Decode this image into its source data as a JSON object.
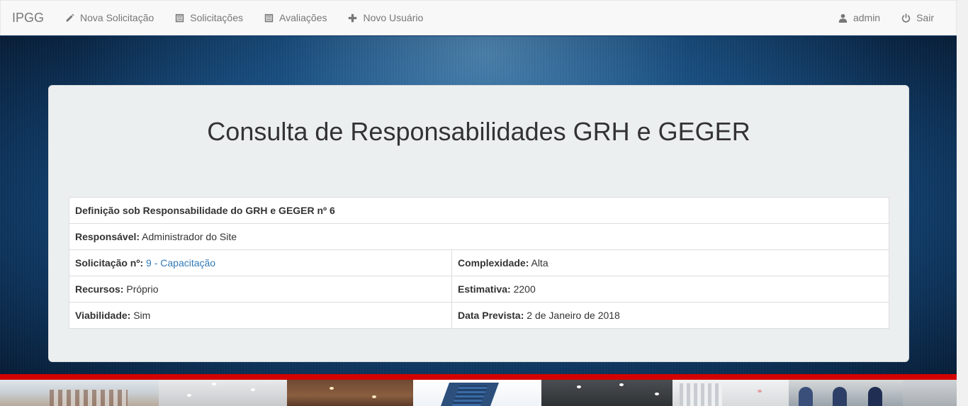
{
  "nav": {
    "brand": "IPGG",
    "items": [
      {
        "label": "Nova Solicitação",
        "icon": "pencil-icon"
      },
      {
        "label": "Solicitações",
        "icon": "list-icon"
      },
      {
        "label": "Avaliações",
        "icon": "list-icon"
      },
      {
        "label": "Novo Usuário",
        "icon": "plus-icon"
      }
    ],
    "user": {
      "label": "admin",
      "icon": "user-icon"
    },
    "logout": {
      "label": "Sair",
      "icon": "power-icon"
    }
  },
  "page": {
    "title": "Consulta de Responsabilidades GRH e GEGER"
  },
  "detail": {
    "header": "Definição sob Responsabilidade do GRH e GEGER nº 6",
    "responsavel_label": "Responsável:",
    "responsavel_value": "Administrador do Site",
    "solicitacao_label": "Solicitação nº:",
    "solicitacao_value": "9 - Capacitação",
    "complexidade_label": "Complexidade:",
    "complexidade_value": "Alta",
    "recursos_label": "Recursos:",
    "recursos_value": "Próprio",
    "estimativa_label": "Estimativa:",
    "estimativa_value": "2200",
    "viabilidade_label": "Viabilidade:",
    "viabilidade_value": "Sim",
    "data_label": "Data Prevista:",
    "data_value": "2 de Janeiro de 2018"
  },
  "colors": {
    "link": "#337ab7",
    "footer_bar": "#d30000"
  }
}
